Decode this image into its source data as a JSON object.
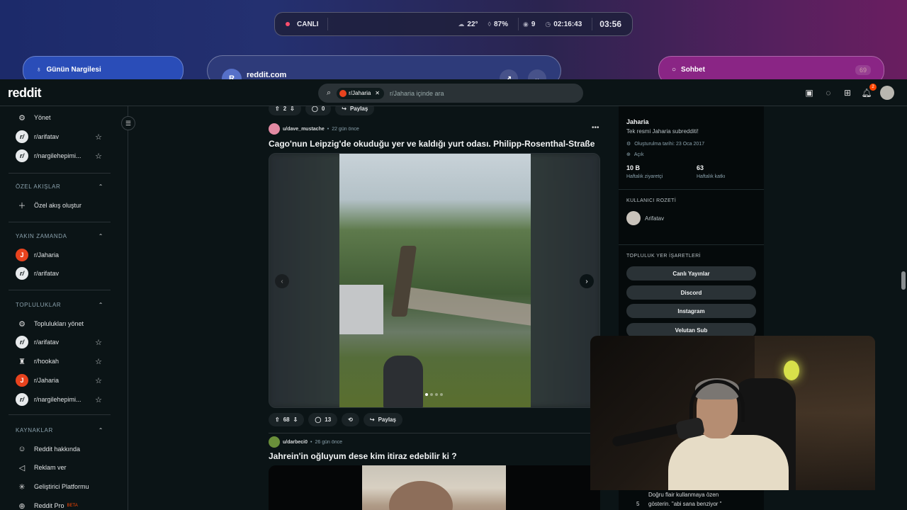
{
  "overlay": {
    "status": {
      "live_label": "CANLI",
      "temperature": "22°",
      "humidity": "87%",
      "viewers": "9",
      "uptime": "02:16:43",
      "clock": "03:56"
    },
    "tabs": {
      "nargile_label": "Günün Nargilesi",
      "reddit_label": "reddit.com",
      "reddit_avatar": "R",
      "sohbet_label": "Sohbet",
      "sohbet_count": "69"
    }
  },
  "header": {
    "logo": "reddit",
    "search_chip": "r/Jaharia",
    "search_placeholder": "r/Jaharia içinde ara",
    "notification_count": "2"
  },
  "sidebar": {
    "top_items": [
      {
        "label": "Yönet"
      },
      {
        "label": "r/arifatav"
      },
      {
        "label": "r/nargilehepimi..."
      }
    ],
    "custom_feeds_heading": "ÖZEL AKIŞLAR",
    "create_feed_label": "Özel akış oluştur",
    "recent_heading": "YAKIN ZAMANDA",
    "recent_items": [
      {
        "label": "r/Jaharia"
      },
      {
        "label": "r/arifatav"
      }
    ],
    "communities_heading": "TOPLULUKLAR",
    "communities_items": [
      {
        "label": "Toplulukları yönet"
      },
      {
        "label": "r/arifatav"
      },
      {
        "label": "r/hookah"
      },
      {
        "label": "r/Jaharia"
      },
      {
        "label": "r/nargilehepimi..."
      }
    ],
    "resources_heading": "KAYNAKLAR",
    "resources_items": [
      {
        "label": "Reddit hakkında"
      },
      {
        "label": "Reklam ver"
      },
      {
        "label": "Geliştirici Platformu"
      },
      {
        "label": "Reddit Pro"
      }
    ],
    "beta_label": "BETA"
  },
  "feed": {
    "prev_post_actions": {
      "votes": "2",
      "comments": "0",
      "share": "Paylaş"
    },
    "post1": {
      "user": "u/dave_mustache",
      "age": "22 gün önce",
      "title": "Cago'nun Leipzig'de okuduğu yer ve kaldığı yurt odası. Philipp-Rosenthal-Straße",
      "votes": "68",
      "comments": "13",
      "share": "Paylaş",
      "gallery_count": 4,
      "gallery_current": 1
    },
    "post2": {
      "user": "u/darbeci0",
      "age": "26 gün önce",
      "title": "Jahrein'in oğluyum dese kim itiraz edebilir ki ?"
    }
  },
  "right_sidebar": {
    "name": "Jaharia",
    "description": "Tek resmi Jaharia subredditi!",
    "created": "Oluşturulma tarihi: 23 Oca 2017",
    "visibility": "Açık",
    "weekly_visitors_value": "10 B",
    "weekly_visitors_label": "Haftalık ziyaretçi",
    "weekly_contrib_value": "63",
    "weekly_contrib_label": "Haftalık katkı",
    "user_flair_heading": "KULLANICI ROZETİ",
    "user_flair_name": "Arifatav",
    "bookmarks_heading": "TOPLULUK YER İŞARETLERİ",
    "bookmarks": [
      "Canlı Yayınlar",
      "Discord",
      "Instagram",
      "Velutan Sub"
    ],
    "rule_text_1": "Doğru flair kullanmaya özen",
    "rule_text_2": "gösterin. \"abi sana benziyor \"",
    "rule_number": "5"
  },
  "colors": {
    "accent": "#ff4500",
    "background": "#0b1416",
    "live": "#ff4d6d"
  }
}
